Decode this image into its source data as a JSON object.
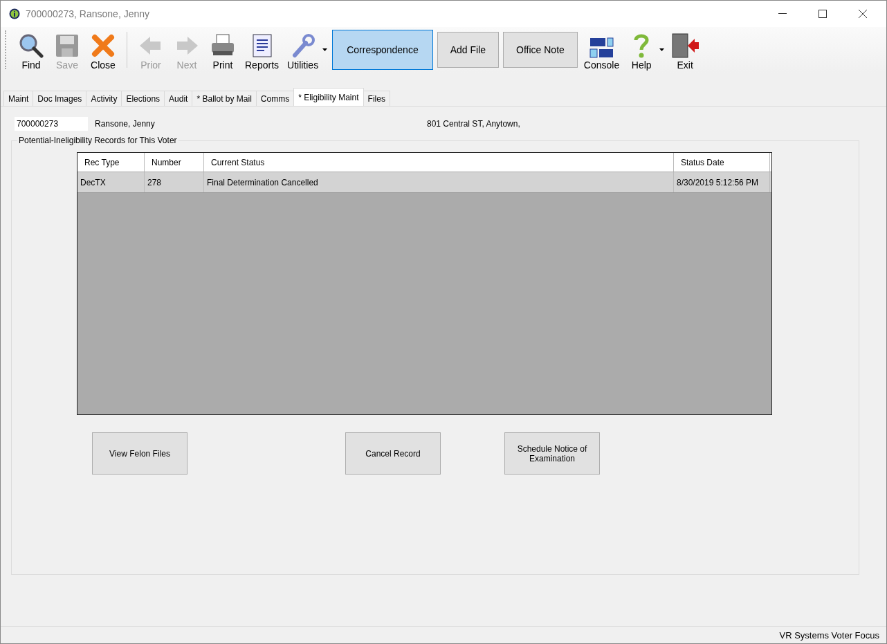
{
  "window": {
    "title": "700000273, Ransone, Jenny"
  },
  "toolbar": [
    {
      "kind": "tool",
      "label": "Find",
      "disabled": false,
      "dropdown": false
    },
    {
      "kind": "tool",
      "label": "Save",
      "disabled": true,
      "dropdown": false
    },
    {
      "kind": "tool",
      "label": "Close",
      "disabled": false,
      "dropdown": false
    },
    {
      "kind": "separator"
    },
    {
      "kind": "tool",
      "label": "Prior",
      "disabled": true,
      "dropdown": false
    },
    {
      "kind": "tool",
      "label": "Next",
      "disabled": true,
      "dropdown": false
    },
    {
      "kind": "tool",
      "label": "Print",
      "disabled": false,
      "dropdown": false
    },
    {
      "kind": "tool",
      "label": "Reports",
      "disabled": false,
      "dropdown": false
    },
    {
      "kind": "tool",
      "label": "Utilities",
      "disabled": false,
      "dropdown": true
    },
    {
      "kind": "button",
      "label": "Correspondence",
      "highlighted": true
    },
    {
      "kind": "button",
      "label": "Add File",
      "highlighted": false
    },
    {
      "kind": "button",
      "label": "Office Note",
      "highlighted": false
    },
    {
      "kind": "tool",
      "label": "Console",
      "disabled": false,
      "dropdown": false
    },
    {
      "kind": "tool",
      "label": "Help",
      "disabled": false,
      "dropdown": true
    },
    {
      "kind": "tool",
      "label": "Exit",
      "disabled": false,
      "dropdown": false
    }
  ],
  "tabs": [
    {
      "label": "Maint",
      "selected": false
    },
    {
      "label": "Doc Images",
      "selected": false
    },
    {
      "label": "Activity",
      "selected": false
    },
    {
      "label": "Elections",
      "selected": false
    },
    {
      "label": "Audit",
      "selected": false
    },
    {
      "label": "* Ballot by Mail",
      "selected": false
    },
    {
      "label": "Comms",
      "selected": false
    },
    {
      "label": "* Eligibility Maint",
      "selected": true
    },
    {
      "label": "Files",
      "selected": false
    }
  ],
  "voter": {
    "id": "700000273",
    "name": "Ransone, Jenny",
    "address": "801 Central ST, Anytown,"
  },
  "records": {
    "title": "Potential-Ineligibility Records for This Voter",
    "columns": [
      "Rec Type",
      "Number",
      "Current Status",
      "Status Date"
    ],
    "rows": [
      {
        "cells": [
          "DecTX",
          "278",
          "Final Determination Cancelled",
          "8/30/2019 5:12:56 PM"
        ],
        "selected": true
      }
    ]
  },
  "actions": [
    "View Felon Files",
    "Cancel Record",
    "Schedule Notice of Examination"
  ],
  "status_bar": {
    "text": "VR Systems Voter Focus"
  }
}
